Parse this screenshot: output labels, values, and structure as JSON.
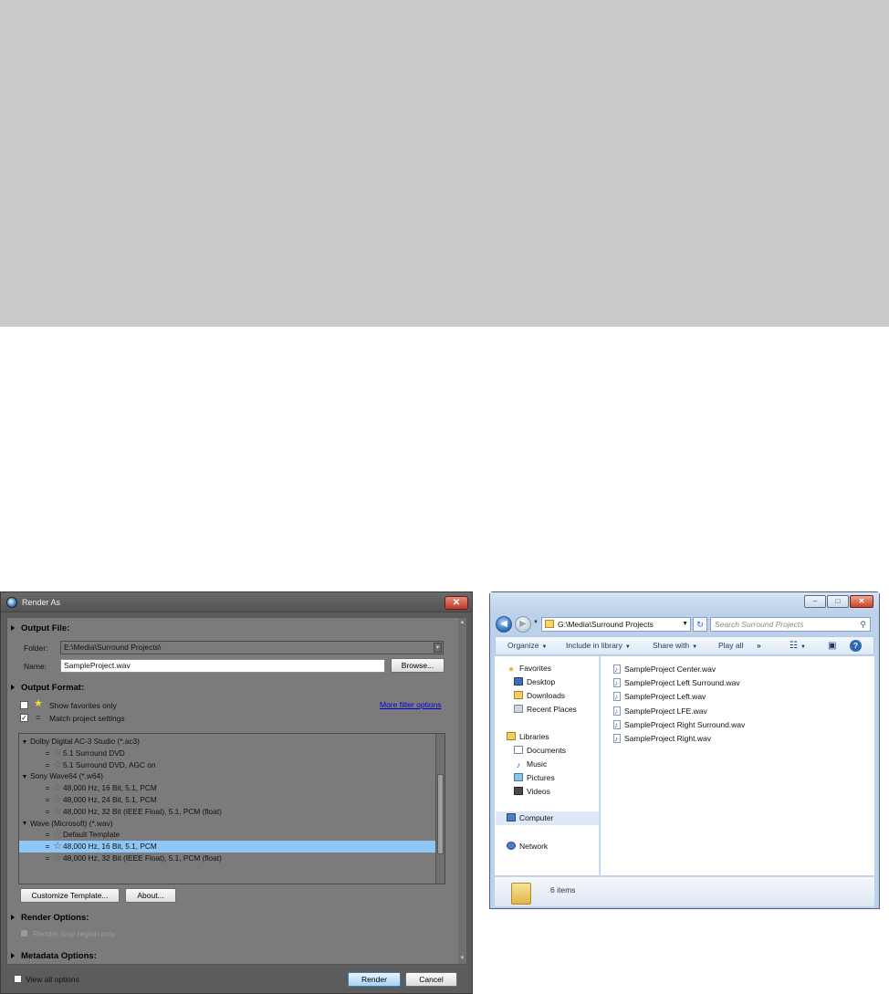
{
  "render_dialog": {
    "title": "Render As",
    "close_glyph": "✕",
    "output_file": {
      "heading": "Output File:",
      "folder_label": "Folder:",
      "folder_value": "E:\\Media\\Surround Projects\\",
      "name_label": "Name:",
      "name_value": "SampleProject.wav",
      "browse_label": "Browse..."
    },
    "output_format": {
      "heading": "Output Format:",
      "show_favorites_label": "Show favorites only",
      "show_favorites_checked": false,
      "match_project_label": "Match project settings",
      "match_project_checked": true,
      "more_filter_link": "More filter options"
    },
    "template_list": [
      {
        "type": "group",
        "label": "Dolby Digital AC-3 Studio (*.ac3)"
      },
      {
        "type": "item",
        "label": "5.1 Surround DVD",
        "selected": false
      },
      {
        "type": "item",
        "label": "5.1 Surround DVD, AGC on",
        "selected": false
      },
      {
        "type": "group",
        "label": "Sony Wave64 (*.w64)"
      },
      {
        "type": "item",
        "label": "48,000 Hz, 16 Bit, 5.1, PCM",
        "selected": false
      },
      {
        "type": "item",
        "label": "48,000 Hz, 24 Bit, 5.1, PCM",
        "selected": false
      },
      {
        "type": "item",
        "label": "48,000 Hz, 32 Bit (IEEE Float), 5.1, PCM (float)",
        "selected": false
      },
      {
        "type": "group",
        "label": "Wave (Microsoft) (*.wav)"
      },
      {
        "type": "item",
        "label": "Default Template",
        "selected": false
      },
      {
        "type": "item",
        "label": "48,000 Hz, 16 Bit, 5.1, PCM",
        "selected": true
      },
      {
        "type": "item",
        "label": "48,000 Hz, 32 Bit (IEEE Float), 5.1, PCM (float)",
        "selected": false
      }
    ],
    "customize_template_label": "Customize Template...",
    "about_label": "About...",
    "render_options": {
      "heading": "Render Options:",
      "loop_region_label": "Render loop region only",
      "loop_region_checked": false
    },
    "metadata_options": {
      "heading": "Metadata Options:"
    },
    "view_all_options_label": "View all options",
    "render_label": "Render",
    "cancel_label": "Cancel",
    "eq_glyph": "=",
    "star_glyph": "☆",
    "fav_star_glyph": "★"
  },
  "explorer": {
    "address_path": "G:\\Media\\Surround Projects",
    "search_placeholder": "Search Surround Projects",
    "back_glyph": "◀",
    "forward_glyph": "▶",
    "refresh_glyph": "↻",
    "search_glyph": "⚲",
    "caption_buttons": {
      "minimize": "–",
      "maximize": "□",
      "close": "✕"
    },
    "commands": {
      "organize": "Organize",
      "include_in_library": "Include in library",
      "share_with": "Share with",
      "play_all": "Play all",
      "more": "»",
      "views_glyph": "☷",
      "preview_glyph": "▣",
      "help_glyph": "?"
    },
    "nav": {
      "favorites": "Favorites",
      "desktop": "Desktop",
      "downloads": "Downloads",
      "recent_places": "Recent Places",
      "libraries": "Libraries",
      "documents": "Documents",
      "music": "Music",
      "pictures": "Pictures",
      "videos": "Videos",
      "computer": "Computer",
      "network": "Network"
    },
    "files": [
      "SampleProject Center.wav",
      "SampleProject Left Surround.wav",
      "SampleProject Left.wav",
      "SampleProject LFE.wav",
      "SampleProject Right Surround.wav",
      "SampleProject Right.wav"
    ],
    "item_count": "6 items"
  }
}
